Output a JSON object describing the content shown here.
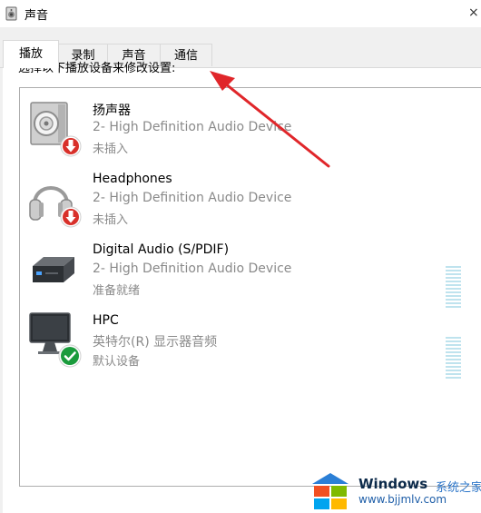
{
  "window": {
    "title": "声音",
    "close_glyph": "×"
  },
  "tabs": [
    {
      "label": "播放",
      "active": true
    },
    {
      "label": "录制",
      "active": false
    },
    {
      "label": "声音",
      "active": false
    },
    {
      "label": "通信",
      "active": false
    }
  ],
  "instruction": "选择以下播放设备来修改设置:",
  "devices": [
    {
      "name": "扬声器",
      "description": "2- High Definition Audio Device",
      "status": "未插入",
      "icon": "speaker-icon",
      "badge": "unplugged-badge-icon"
    },
    {
      "name": "Headphones",
      "description": "2- High Definition Audio Device",
      "status": "未插入",
      "icon": "headphones-icon",
      "badge": "unplugged-badge-icon"
    },
    {
      "name": "Digital Audio (S/PDIF)",
      "description": "2- High Definition Audio Device",
      "status": "准备就绪",
      "icon": "digital-audio-device-icon",
      "badge": null
    },
    {
      "name": "HPC",
      "description": "英特尔(R) 显示器音频",
      "status": "默认设备",
      "icon": "monitor-icon",
      "badge": "default-check-badge-icon"
    }
  ],
  "watermark": {
    "brand": "Windows",
    "suffix": "系统之家",
    "url": "www.bjjmlv.com"
  },
  "colors": {
    "arrow": "#e0262a",
    "meter": "#bfe3ee",
    "accent": "#0078d7"
  }
}
